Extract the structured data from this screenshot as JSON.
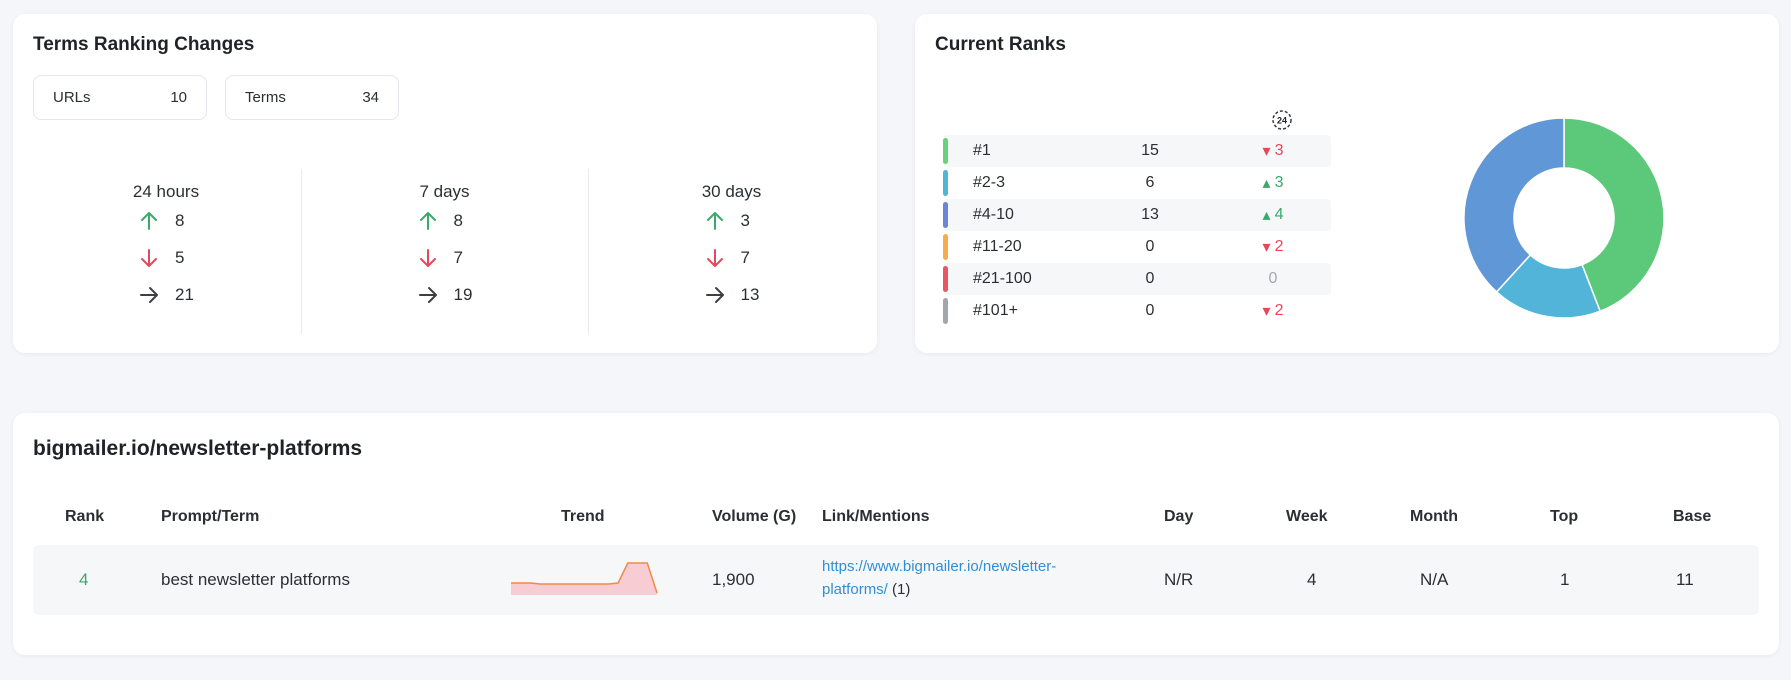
{
  "changes_card": {
    "title": "Terms Ranking Changes",
    "urls_label": "URLs",
    "urls_value": "10",
    "terms_label": "Terms",
    "terms_value": "34",
    "periods": [
      {
        "label": "24 hours",
        "up": "8",
        "down": "5",
        "flat": "21"
      },
      {
        "label": "7 days",
        "up": "8",
        "down": "7",
        "flat": "19"
      },
      {
        "label": "30 days",
        "up": "3",
        "down": "7",
        "flat": "13"
      }
    ],
    "colors": {
      "up": "#3aa96a",
      "down": "#e5485a",
      "flat": "#3a3f45"
    }
  },
  "ranks_card": {
    "title": "Current Ranks",
    "period_badge": "24",
    "rows": [
      {
        "label": "#1",
        "count": "15",
        "delta": "3",
        "dir": "down",
        "color": "#69d17c"
      },
      {
        "label": "#2-3",
        "count": "6",
        "delta": "3",
        "dir": "up",
        "color": "#4fb6d6"
      },
      {
        "label": "#4-10",
        "count": "13",
        "delta": "4",
        "dir": "up",
        "color": "#6a86d8"
      },
      {
        "label": "#11-20",
        "count": "0",
        "delta": "2",
        "dir": "down",
        "color": "#f6ac4a"
      },
      {
        "label": "#21-100",
        "count": "0",
        "delta": "0",
        "dir": "flat",
        "color": "#ea5565"
      },
      {
        "label": "#101+",
        "count": "0",
        "delta": "2",
        "dir": "down",
        "color": "#a3a6ab"
      }
    ],
    "chart_data": {
      "type": "pie",
      "donut": true,
      "categories": [
        "#1",
        "#2-3",
        "#4-10",
        "#11-20",
        "#21-100",
        "#101+"
      ],
      "values": [
        15,
        6,
        13,
        0,
        0,
        0
      ],
      "colors": [
        "#5cc97a",
        "#52b4d9",
        "#6097d6",
        "#f6ac4a",
        "#ea5565",
        "#a3a6ab"
      ]
    }
  },
  "table_card": {
    "title": "bigmailer.io/newsletter-platforms",
    "headers": {
      "rank": "Rank",
      "term": "Prompt/Term",
      "trend": "Trend",
      "volume": "Volume (G)",
      "link": "Link/Mentions",
      "day": "Day",
      "week": "Week",
      "month": "Month",
      "top": "Top",
      "base": "Base"
    },
    "rows": [
      {
        "rank": "4",
        "term": "best newsletter platforms",
        "trend": [
          10,
          10,
          10,
          9,
          9,
          9,
          9,
          9,
          9,
          9,
          9,
          10,
          30,
          30,
          30,
          0
        ],
        "volume": "1,900",
        "link_line1": "https://www.bigmailer.io/newsletter-",
        "link_line2": "platforms/",
        "mentions": "(1)",
        "day": "N/R",
        "week": "4",
        "month": "N/A",
        "top": "1",
        "base": "11"
      }
    ],
    "colors": {
      "rank": "#3aa96a",
      "trend_line": "#f08a4a",
      "trend_fill": "#f7c6cc"
    }
  }
}
